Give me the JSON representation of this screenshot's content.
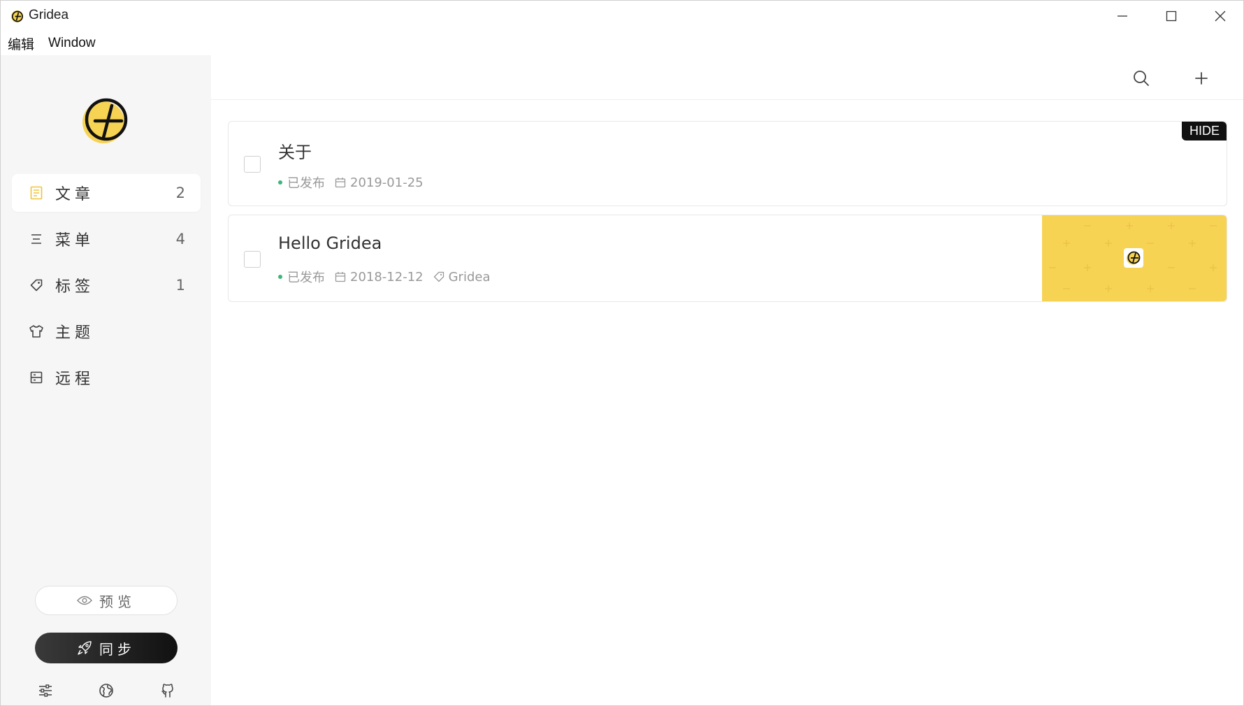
{
  "window": {
    "title": "Gridea",
    "controls": [
      "minimize",
      "maximize",
      "close"
    ]
  },
  "menubar": {
    "items": [
      "编辑",
      "Window"
    ]
  },
  "sidebar": {
    "logo": "gridea-logo",
    "items": [
      {
        "label": "文章",
        "count": "2",
        "icon": "article-icon",
        "active": true
      },
      {
        "label": "菜单",
        "count": "4",
        "icon": "menu-icon",
        "active": false
      },
      {
        "label": "标签",
        "count": "1",
        "icon": "tag-icon",
        "active": false
      },
      {
        "label": "主题",
        "count": "",
        "icon": "shirt-icon",
        "active": false
      },
      {
        "label": "远程",
        "count": "",
        "icon": "server-icon",
        "active": false
      }
    ],
    "preview_label": "预览",
    "sync_label": "同步",
    "footer_icons": [
      "settings-icon",
      "globe-icon",
      "github-icon"
    ]
  },
  "toolbar": {
    "icons": [
      "search-icon",
      "add-icon"
    ]
  },
  "posts": [
    {
      "title": "关于",
      "status": "已发布",
      "date": "2019-01-25",
      "tag": "",
      "badge": "HIDE",
      "has_thumbnail": false
    },
    {
      "title": "Hello Gridea",
      "status": "已发布",
      "date": "2018-12-12",
      "tag": "Gridea",
      "badge": "",
      "has_thumbnail": true
    }
  ],
  "colors": {
    "accent_yellow": "#f7d354",
    "status_green": "#3fb57b",
    "sidebar_bg": "#f7f6f6",
    "sync_button": "#111111"
  }
}
